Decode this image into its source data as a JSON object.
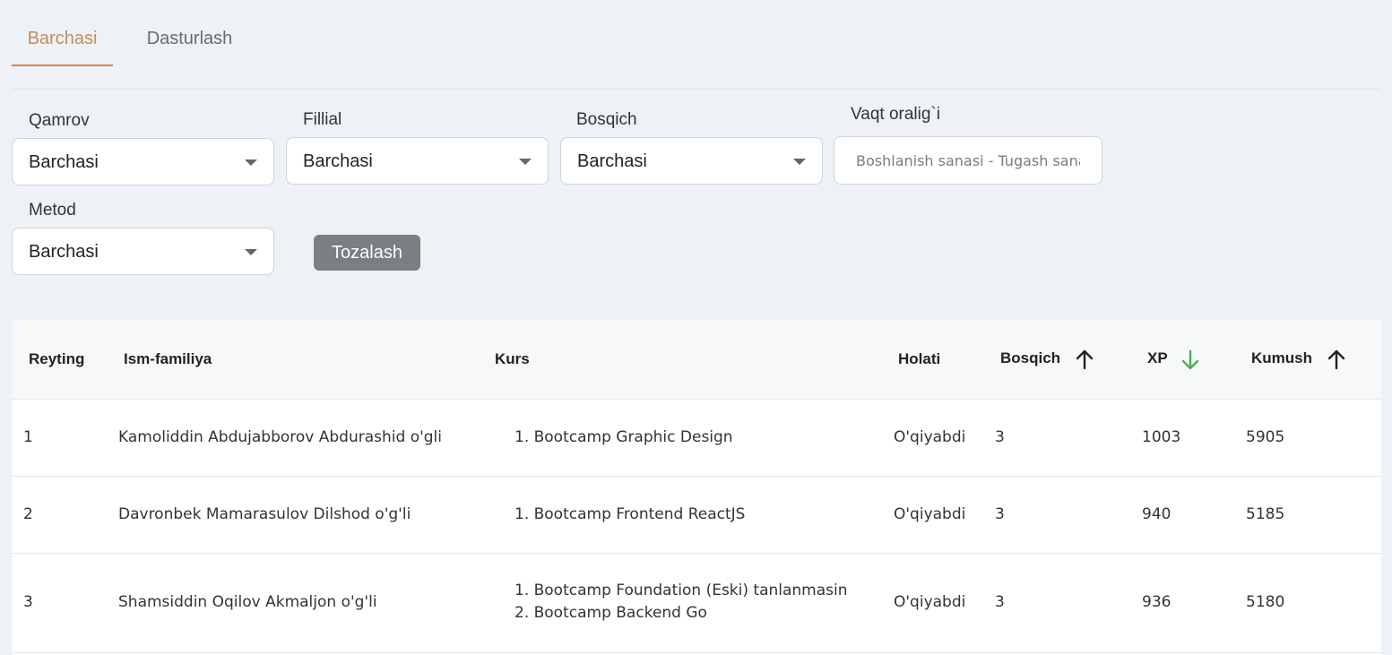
{
  "tabs": [
    {
      "label": "Barchasi",
      "active": true
    },
    {
      "label": "Dasturlash",
      "active": false
    }
  ],
  "filters": {
    "qamrov": {
      "label": "Qamrov",
      "value": "Barchasi"
    },
    "fillial": {
      "label": "Fillial",
      "value": "Barchasi"
    },
    "bosqich": {
      "label": "Bosqich",
      "value": "Barchasi"
    },
    "vaqt": {
      "label": "Vaqt oralig`i",
      "placeholder": "Boshlanish sanasi - Tugash sanasi"
    },
    "metod": {
      "label": "Metod",
      "value": "Barchasi"
    },
    "clear_label": "Tozalash"
  },
  "table": {
    "headers": {
      "reyting": "Reyting",
      "ism": "Ism-familiya",
      "kurs": "Kurs",
      "holati": "Holati",
      "bosqich": "Bosqich",
      "xp": "XP",
      "kumush": "Kumush"
    },
    "sort": {
      "bosqich": "arrow-up-icon",
      "xp": "arrow-down-icon",
      "kumush": "arrow-up-icon",
      "active_color": "#4caf50"
    },
    "rows": [
      {
        "rank": "1",
        "name": "Kamoliddin Abdujabborov Abdurashid o'gli",
        "courses": [
          "1. Bootcamp Graphic Design"
        ],
        "status": "O'qiyabdi",
        "stage": "3",
        "xp": "1003",
        "silver": "5905"
      },
      {
        "rank": "2",
        "name": "Davronbek Mamarasulov Dilshod o'g'li",
        "courses": [
          "1. Bootcamp Frontend ReactJS"
        ],
        "status": "O'qiyabdi",
        "stage": "3",
        "xp": "940",
        "silver": "5185"
      },
      {
        "rank": "3",
        "name": "Shamsiddin Oqilov Akmaljon o'g'li",
        "courses": [
          "1. Bootcamp Foundation (Eski) tanlanmasin",
          "2. Bootcamp Backend Go"
        ],
        "status": "O'qiyabdi",
        "stage": "3",
        "xp": "936",
        "silver": "5180"
      }
    ]
  }
}
